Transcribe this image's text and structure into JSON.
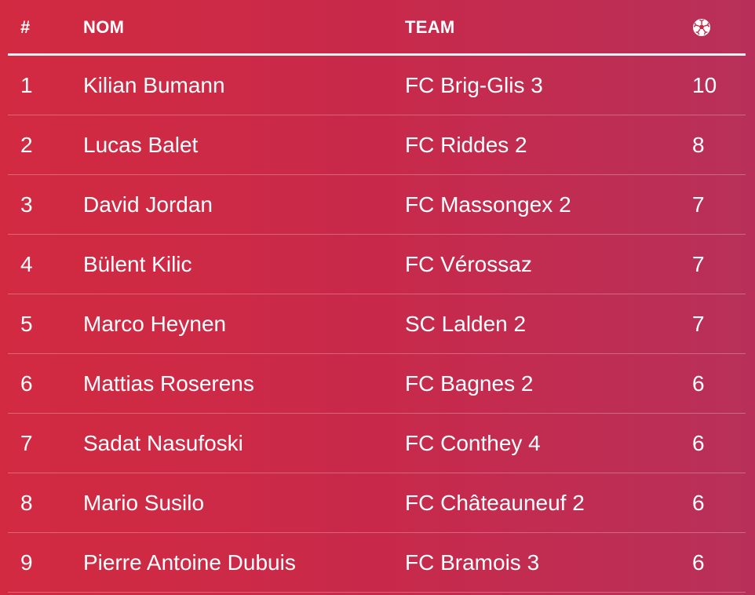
{
  "header": {
    "rank": "#",
    "name": "NOM",
    "team": "TEAM",
    "goals_icon": "soccer-ball-icon"
  },
  "rows": [
    {
      "rank": "1",
      "name": "Kilian Bumann",
      "team": "FC Brig-Glis 3",
      "goals": "10"
    },
    {
      "rank": "2",
      "name": "Lucas Balet",
      "team": "FC Riddes 2",
      "goals": "8"
    },
    {
      "rank": "3",
      "name": "David Jordan",
      "team": "FC Massongex 2",
      "goals": "7"
    },
    {
      "rank": "4",
      "name": "Bülent Kilic",
      "team": "FC Vérossaz",
      "goals": "7"
    },
    {
      "rank": "5",
      "name": "Marco Heynen",
      "team": "SC Lalden 2",
      "goals": "7"
    },
    {
      "rank": "6",
      "name": "Mattias Roserens",
      "team": "FC Bagnes 2",
      "goals": "6"
    },
    {
      "rank": "7",
      "name": "Sadat Nasufoski",
      "team": "FC Conthey 4",
      "goals": "6"
    },
    {
      "rank": "8",
      "name": "Mario Susilo",
      "team": "FC Châteauneuf 2",
      "goals": "6"
    },
    {
      "rank": "9",
      "name": "Pierre Antoine Dubuis",
      "team": "FC Bramois 3",
      "goals": "6"
    }
  ],
  "colors": {
    "background_start": "#d22a41",
    "background_end": "#b8305a",
    "text": "#ffffff"
  }
}
